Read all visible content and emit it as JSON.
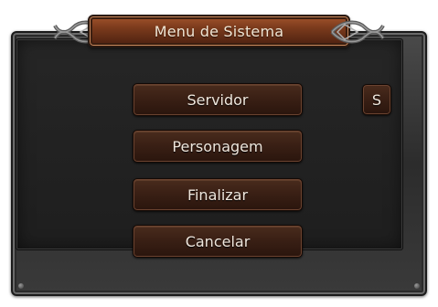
{
  "window": {
    "title": "Menu de Sistema"
  },
  "menu": {
    "items": [
      {
        "label": "Servidor"
      },
      {
        "label": "Personagem"
      },
      {
        "label": "Finalizar"
      },
      {
        "label": "Cancelar"
      }
    ],
    "shortcut_label": "S"
  },
  "icons": {
    "title_left": "celtic-knot-ornament-icon",
    "title_right": "celtic-knot-ornament-icon"
  },
  "colors": {
    "title_plate": "#7a3a1c",
    "button_face": "#3a2015",
    "button_text": "#efe6dc",
    "frame": "#3a3a3a",
    "panel": "#222222"
  }
}
